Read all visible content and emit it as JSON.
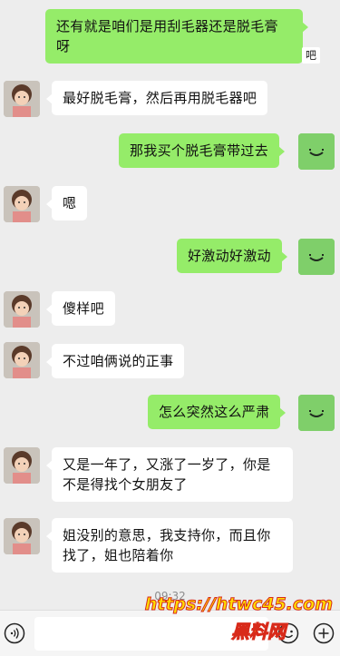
{
  "messages": [
    {
      "side": "me",
      "text": "还有就是咱们是用刮毛器还是脱毛膏呀"
    },
    {
      "side": "other",
      "text": "最好脱毛膏，然后再用脱毛器吧"
    },
    {
      "side": "me",
      "text": "那我买个脱毛膏带过去"
    },
    {
      "side": "other",
      "text": "嗯"
    },
    {
      "side": "me",
      "text": "好激动好激动"
    },
    {
      "side": "other",
      "text": "傻样吧"
    },
    {
      "side": "other",
      "text": "不过咱俩说的正事"
    },
    {
      "side": "me",
      "text": "怎么突然这么严肃"
    },
    {
      "side": "other",
      "text": "又是一年了，又涨了一岁了，你是不是得找个女朋友了"
    },
    {
      "side": "other",
      "text": "姐没别的意思，我支持你，而且你找了，姐也陪着你"
    }
  ],
  "badge": "吧",
  "timestamp": "09:32",
  "watermark": {
    "line1": "https://htwc45.com",
    "line2": "黑料网"
  },
  "colors": {
    "me_bubble": "#95ec69",
    "other_bubble": "#ffffff",
    "background": "#ededed"
  },
  "icons": {
    "voice": "voice-icon",
    "emoji": "emoji-icon",
    "plus": "plus-icon"
  }
}
